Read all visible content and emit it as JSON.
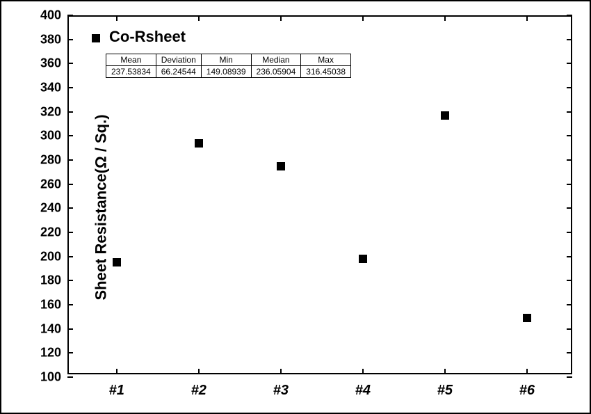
{
  "chart_data": {
    "type": "scatter",
    "title": "Co-Rsheet",
    "ylabel": "Sheet Resistance(Ω / Sq.)",
    "xlabel": "",
    "categories": [
      "#1",
      "#2",
      "#3",
      "#4",
      "#5",
      "#6"
    ],
    "values": [
      195,
      294,
      275,
      198,
      317,
      149
    ],
    "ylim": [
      100,
      400
    ],
    "yticks": [
      100,
      120,
      140,
      160,
      180,
      200,
      220,
      240,
      260,
      280,
      300,
      320,
      340,
      360,
      380,
      400
    ],
    "stats": {
      "headers": [
        "Mean",
        "Deviation",
        "Min",
        "Median",
        "Max"
      ],
      "values": [
        "237.53834",
        "66.24544",
        "149.08939",
        "236.05904",
        "316.45038"
      ]
    }
  }
}
